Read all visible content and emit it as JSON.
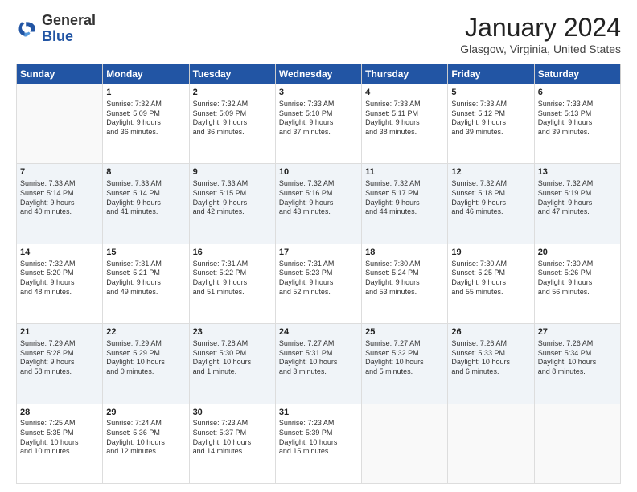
{
  "header": {
    "logo_general": "General",
    "logo_blue": "Blue",
    "month_title": "January 2024",
    "location": "Glasgow, Virginia, United States"
  },
  "days_of_week": [
    "Sunday",
    "Monday",
    "Tuesday",
    "Wednesday",
    "Thursday",
    "Friday",
    "Saturday"
  ],
  "weeks": [
    [
      {
        "day": "",
        "info": ""
      },
      {
        "day": "1",
        "info": "Sunrise: 7:32 AM\nSunset: 5:09 PM\nDaylight: 9 hours\nand 36 minutes."
      },
      {
        "day": "2",
        "info": "Sunrise: 7:32 AM\nSunset: 5:09 PM\nDaylight: 9 hours\nand 36 minutes."
      },
      {
        "day": "3",
        "info": "Sunrise: 7:33 AM\nSunset: 5:10 PM\nDaylight: 9 hours\nand 37 minutes."
      },
      {
        "day": "4",
        "info": "Sunrise: 7:33 AM\nSunset: 5:11 PM\nDaylight: 9 hours\nand 38 minutes."
      },
      {
        "day": "5",
        "info": "Sunrise: 7:33 AM\nSunset: 5:12 PM\nDaylight: 9 hours\nand 39 minutes."
      },
      {
        "day": "6",
        "info": "Sunrise: 7:33 AM\nSunset: 5:13 PM\nDaylight: 9 hours\nand 39 minutes."
      }
    ],
    [
      {
        "day": "7",
        "info": "Sunrise: 7:33 AM\nSunset: 5:14 PM\nDaylight: 9 hours\nand 40 minutes."
      },
      {
        "day": "8",
        "info": "Sunrise: 7:33 AM\nSunset: 5:14 PM\nDaylight: 9 hours\nand 41 minutes."
      },
      {
        "day": "9",
        "info": "Sunrise: 7:33 AM\nSunset: 5:15 PM\nDaylight: 9 hours\nand 42 minutes."
      },
      {
        "day": "10",
        "info": "Sunrise: 7:32 AM\nSunset: 5:16 PM\nDaylight: 9 hours\nand 43 minutes."
      },
      {
        "day": "11",
        "info": "Sunrise: 7:32 AM\nSunset: 5:17 PM\nDaylight: 9 hours\nand 44 minutes."
      },
      {
        "day": "12",
        "info": "Sunrise: 7:32 AM\nSunset: 5:18 PM\nDaylight: 9 hours\nand 46 minutes."
      },
      {
        "day": "13",
        "info": "Sunrise: 7:32 AM\nSunset: 5:19 PM\nDaylight: 9 hours\nand 47 minutes."
      }
    ],
    [
      {
        "day": "14",
        "info": "Sunrise: 7:32 AM\nSunset: 5:20 PM\nDaylight: 9 hours\nand 48 minutes."
      },
      {
        "day": "15",
        "info": "Sunrise: 7:31 AM\nSunset: 5:21 PM\nDaylight: 9 hours\nand 49 minutes."
      },
      {
        "day": "16",
        "info": "Sunrise: 7:31 AM\nSunset: 5:22 PM\nDaylight: 9 hours\nand 51 minutes."
      },
      {
        "day": "17",
        "info": "Sunrise: 7:31 AM\nSunset: 5:23 PM\nDaylight: 9 hours\nand 52 minutes."
      },
      {
        "day": "18",
        "info": "Sunrise: 7:30 AM\nSunset: 5:24 PM\nDaylight: 9 hours\nand 53 minutes."
      },
      {
        "day": "19",
        "info": "Sunrise: 7:30 AM\nSunset: 5:25 PM\nDaylight: 9 hours\nand 55 minutes."
      },
      {
        "day": "20",
        "info": "Sunrise: 7:30 AM\nSunset: 5:26 PM\nDaylight: 9 hours\nand 56 minutes."
      }
    ],
    [
      {
        "day": "21",
        "info": "Sunrise: 7:29 AM\nSunset: 5:28 PM\nDaylight: 9 hours\nand 58 minutes."
      },
      {
        "day": "22",
        "info": "Sunrise: 7:29 AM\nSunset: 5:29 PM\nDaylight: 10 hours\nand 0 minutes."
      },
      {
        "day": "23",
        "info": "Sunrise: 7:28 AM\nSunset: 5:30 PM\nDaylight: 10 hours\nand 1 minute."
      },
      {
        "day": "24",
        "info": "Sunrise: 7:27 AM\nSunset: 5:31 PM\nDaylight: 10 hours\nand 3 minutes."
      },
      {
        "day": "25",
        "info": "Sunrise: 7:27 AM\nSunset: 5:32 PM\nDaylight: 10 hours\nand 5 minutes."
      },
      {
        "day": "26",
        "info": "Sunrise: 7:26 AM\nSunset: 5:33 PM\nDaylight: 10 hours\nand 6 minutes."
      },
      {
        "day": "27",
        "info": "Sunrise: 7:26 AM\nSunset: 5:34 PM\nDaylight: 10 hours\nand 8 minutes."
      }
    ],
    [
      {
        "day": "28",
        "info": "Sunrise: 7:25 AM\nSunset: 5:35 PM\nDaylight: 10 hours\nand 10 minutes."
      },
      {
        "day": "29",
        "info": "Sunrise: 7:24 AM\nSunset: 5:36 PM\nDaylight: 10 hours\nand 12 minutes."
      },
      {
        "day": "30",
        "info": "Sunrise: 7:23 AM\nSunset: 5:37 PM\nDaylight: 10 hours\nand 14 minutes."
      },
      {
        "day": "31",
        "info": "Sunrise: 7:23 AM\nSunset: 5:39 PM\nDaylight: 10 hours\nand 15 minutes."
      },
      {
        "day": "",
        "info": ""
      },
      {
        "day": "",
        "info": ""
      },
      {
        "day": "",
        "info": ""
      }
    ]
  ]
}
